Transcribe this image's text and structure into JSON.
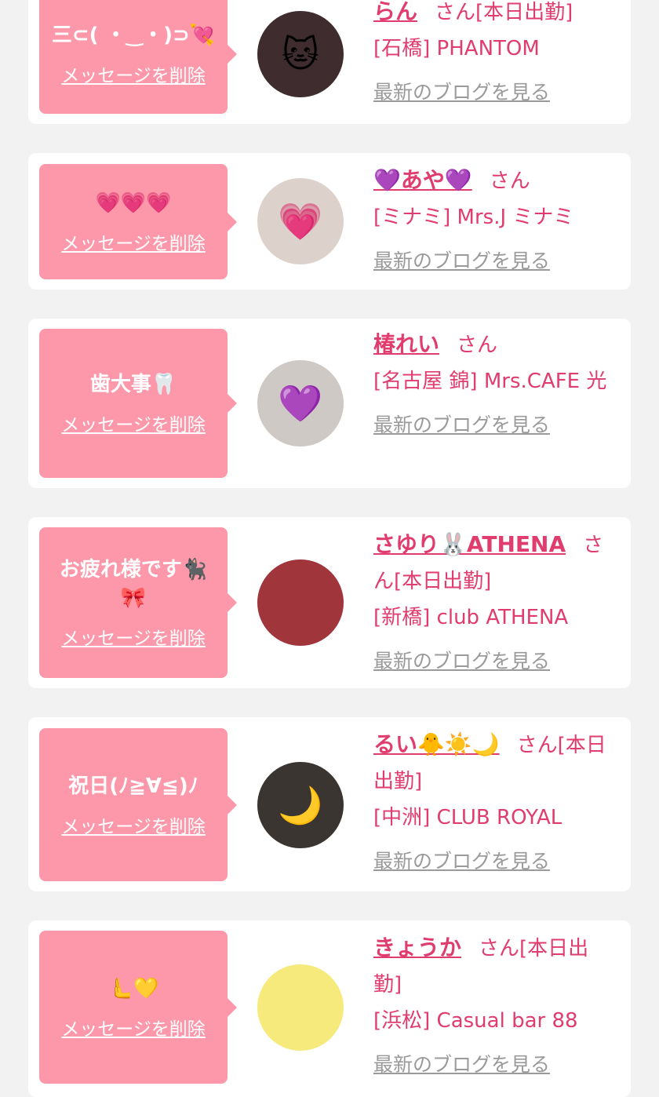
{
  "messages": [
    {
      "message": "三⊂( ・‿・)⊃💘",
      "delete_label": "メッセージを削除",
      "avatar_icon": "🐱",
      "avatar_bg": "#3e2c2f",
      "name": "らん",
      "honorific": "さん",
      "status": "[本日出勤]",
      "shop": "[石橋] PHANTOM",
      "blog_label": "最新のブログを見る"
    },
    {
      "message": "💗💗💗",
      "delete_label": "メッセージを削除",
      "avatar_icon": "💗",
      "avatar_bg": "#ddd2cb",
      "name": "💜あや💜",
      "honorific": "さん",
      "status": "",
      "shop": "[ミナミ] Mrs.J ミナミ",
      "blog_label": "最新のブログを見る"
    },
    {
      "message": "歯大事🦷",
      "delete_label": "メッセージを削除",
      "avatar_icon": "💜",
      "avatar_bg": "#cfc9c5",
      "name": "椿れい",
      "honorific": "さん",
      "status": "",
      "shop": "[名古屋 錦] Mrs.CAFE 光",
      "blog_label": "最新のブログを見る"
    },
    {
      "message": "お疲れ様です🐈‍⬛🎀",
      "delete_label": "メッセージを削除",
      "avatar_icon": "",
      "avatar_bg": "#a0353c",
      "name": "さゆり🐰ATHENA",
      "honorific": "さん",
      "status": "[本日出勤]",
      "shop": "[新橋] club ATHENA",
      "blog_label": "最新のブログを見る"
    },
    {
      "message": "祝日(ﾉ≧∀≦)ﾉ",
      "delete_label": "メッセージを削除",
      "avatar_icon": "🌙",
      "avatar_bg": "#3b3532",
      "name": "るい🐥☀️🌙",
      "honorific": "さん",
      "status": "[本日出勤]",
      "shop": "[中洲] CLUB ROYAL",
      "blog_label": "最新のブログを見る"
    },
    {
      "message": "🫷💛",
      "delete_label": "メッセージを削除",
      "avatar_icon": "",
      "avatar_bg": "#f7ea7c",
      "name": "きょうか",
      "honorific": "さん",
      "status": "[本日出勤]",
      "shop": "[浜松] Casual bar 88",
      "blog_label": "最新のブログを見る"
    }
  ]
}
